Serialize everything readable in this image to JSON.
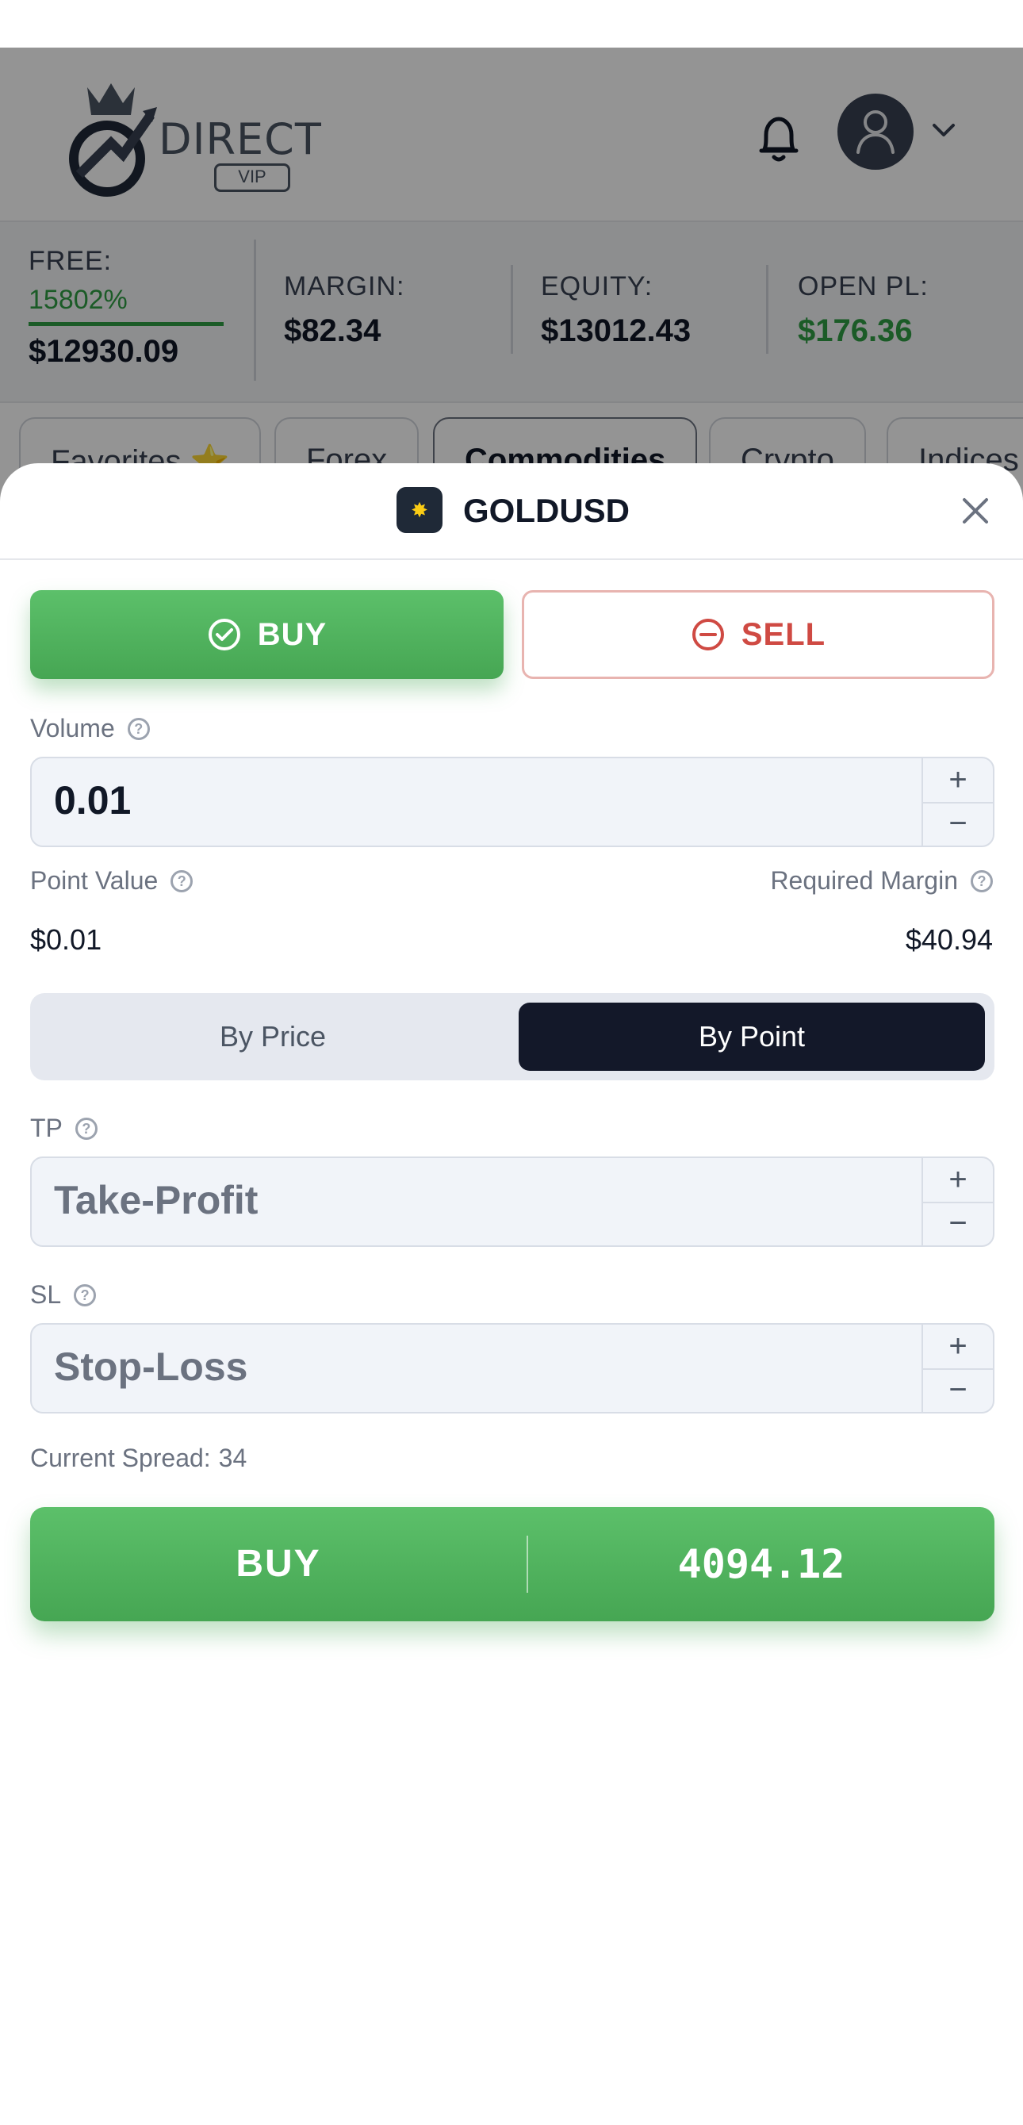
{
  "header": {
    "logo_text": "DIRECT",
    "logo_sub": "VIP"
  },
  "stats": {
    "free": {
      "label": "FREE:",
      "percent": "15802%",
      "value": "$12930.09"
    },
    "margin": {
      "label": "MARGIN:",
      "value": "$82.34"
    },
    "equity": {
      "label": "EQUITY:",
      "value": "$13012.43"
    },
    "open_pl": {
      "label": "OPEN PL:",
      "value": "$176.36"
    }
  },
  "tabs": [
    "Favorites ⭐",
    "Forex",
    "Commodities",
    "Crypto",
    "Indices"
  ],
  "order": {
    "symbol": "GOLDUSD",
    "buy_toggle": "BUY",
    "sell_toggle": "SELL",
    "volume_label": "Volume",
    "volume_value": "0.01",
    "point_value_label": "Point Value",
    "point_value": "$0.01",
    "required_margin_label": "Required Margin",
    "required_margin": "$40.94",
    "mode_by_price": "By Price",
    "mode_by_point": "By Point",
    "tp_label": "TP",
    "tp_placeholder": "Take-Profit",
    "sl_label": "SL",
    "sl_placeholder": "Stop-Loss",
    "spread_label": "Current Spread:",
    "spread_value": "34",
    "submit_label": "BUY",
    "submit_price": "4094.12"
  },
  "colors": {
    "buy": "#4caf5a",
    "sell": "#cf4a43",
    "active_segment": "#131829",
    "positive": "#2f9e44"
  },
  "icons": {
    "symbol": "gold-coin-icon",
    "close": "close-icon",
    "help": "question-circle-icon",
    "buy": "check-circle-icon",
    "sell": "minus-circle-icon",
    "notification": "bell-icon",
    "user": "user-icon",
    "chevron": "chevron-down-icon"
  }
}
